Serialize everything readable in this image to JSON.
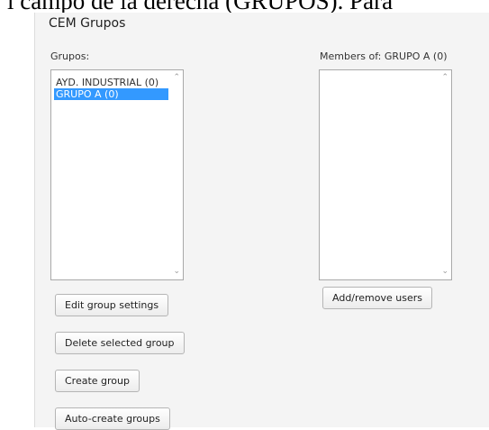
{
  "background_text": "l campo de la derecha (GRUPOS). Para",
  "panel": {
    "title": "CEM Grupos",
    "groups_label": "Grupos:",
    "members_label": "Members of: GRUPO A (0)"
  },
  "groups_list": {
    "items": [
      {
        "label": "AYD. INDUSTRIAL (0)",
        "selected": false
      },
      {
        "label": "GRUPO A (0)",
        "selected": true
      }
    ]
  },
  "members_list": {
    "items": []
  },
  "buttons": {
    "edit_group_settings": "Edit group settings",
    "add_remove_users": "Add/remove users",
    "delete_selected_group": "Delete selected group",
    "create_group": "Create group",
    "auto_create_groups": "Auto-create groups"
  },
  "colors": {
    "selection": "#3399ff",
    "panel_bg": "#f4f4f4"
  }
}
